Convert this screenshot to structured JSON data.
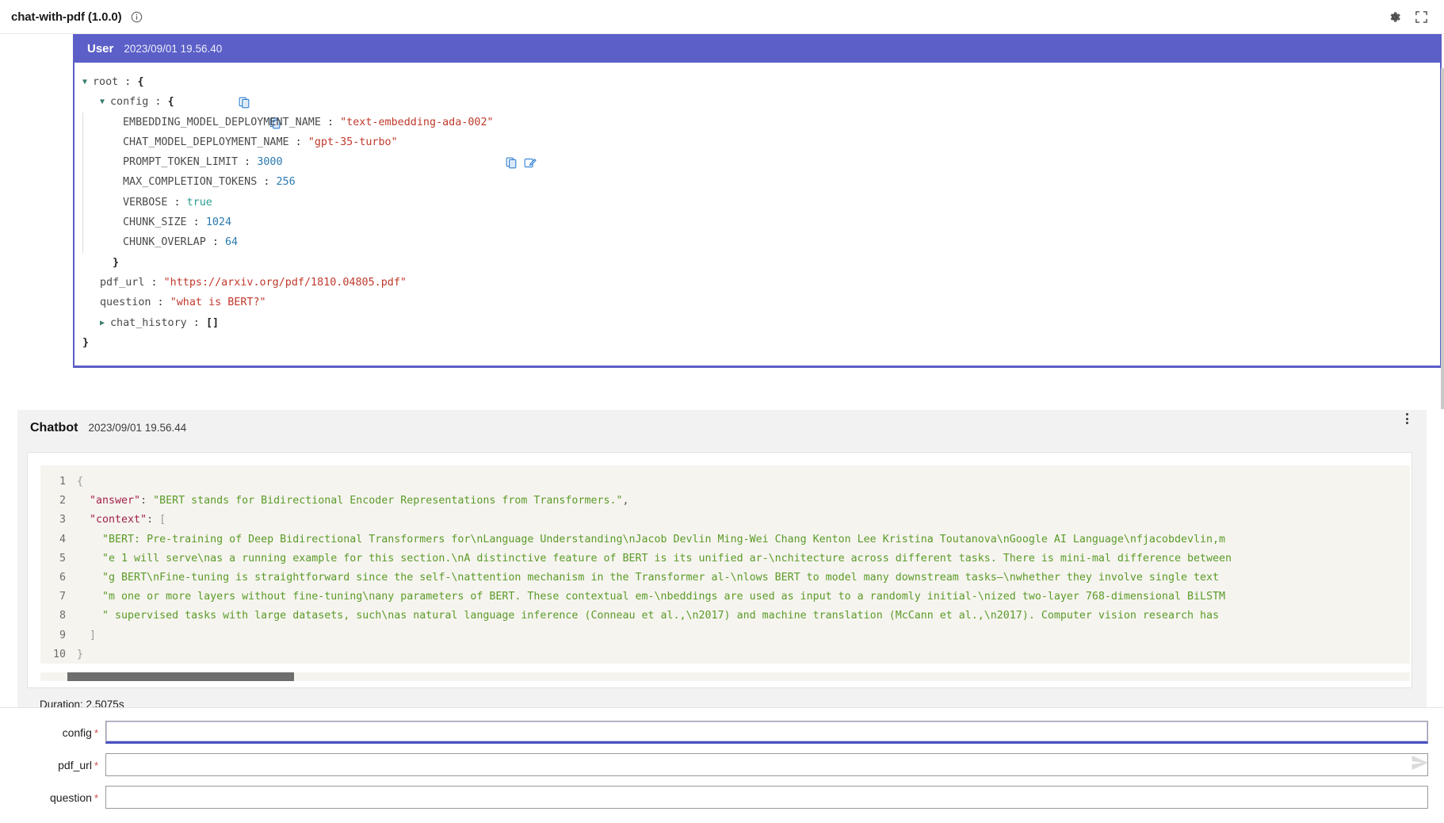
{
  "topbar": {
    "title": "chat-with-pdf (1.0.0)",
    "info_icon": "info-circle-icon",
    "settings_icon": "gear-icon",
    "fullscreen_icon": "expand-icon"
  },
  "user_message": {
    "role": "User",
    "timestamp": "2023/09/01 19.56.40",
    "tree": {
      "root_label": "root",
      "root_open_brace": "{",
      "config_label": "config",
      "config_open_brace": "{",
      "config_close_brace": "}",
      "root_close_brace": "}",
      "fields": [
        {
          "key": "EMBEDDING_MODEL_DEPLOYMENT_NAME",
          "value": "\"text-embedding-ada-002\"",
          "type": "string"
        },
        {
          "key": "CHAT_MODEL_DEPLOYMENT_NAME",
          "value": "\"gpt-35-turbo\"",
          "type": "string"
        },
        {
          "key": "PROMPT_TOKEN_LIMIT",
          "value": "3000",
          "type": "number"
        },
        {
          "key": "MAX_COMPLETION_TOKENS",
          "value": "256",
          "type": "number"
        },
        {
          "key": "VERBOSE",
          "value": "true",
          "type": "boolean"
        },
        {
          "key": "CHUNK_SIZE",
          "value": "1024",
          "type": "number"
        },
        {
          "key": "CHUNK_OVERLAP",
          "value": "64",
          "type": "number"
        }
      ],
      "pdf_url_key": "pdf_url",
      "pdf_url_value": "\"https://arxiv.org/pdf/1810.04805.pdf\"",
      "question_key": "question",
      "question_value": "\"what is BERT?\"",
      "chat_history_key": "chat_history",
      "chat_history_value": "[]",
      "colon": " : ",
      "copy_icon": "copy-icon",
      "edit_icon": "edit-icon"
    }
  },
  "bot_message": {
    "role": "Chatbot",
    "timestamp": "2023/09/01 19.56.44",
    "menu_icon": "kebab-menu-icon",
    "duration": "Duration: 2.5075s",
    "code": {
      "lines": [
        {
          "n": "1",
          "segments": [
            {
              "t": "punct",
              "s": "{"
            }
          ]
        },
        {
          "n": "2",
          "segments": [
            {
              "t": "plain",
              "s": "  "
            },
            {
              "t": "key",
              "s": "\"answer\""
            },
            {
              "t": "colon",
              "s": ": "
            },
            {
              "t": "str",
              "s": "\"BERT stands for Bidirectional Encoder Representations from Transformers.\""
            },
            {
              "t": "colon",
              "s": ","
            }
          ]
        },
        {
          "n": "3",
          "segments": [
            {
              "t": "plain",
              "s": "  "
            },
            {
              "t": "key",
              "s": "\"context\""
            },
            {
              "t": "colon",
              "s": ": "
            },
            {
              "t": "punct",
              "s": "["
            }
          ]
        },
        {
          "n": "4",
          "segments": [
            {
              "t": "plain",
              "s": "    "
            },
            {
              "t": "str",
              "s": "\"BERT: Pre-training of Deep Bidirectional Transformers for\\nLanguage Understanding\\nJacob Devlin Ming-Wei Chang Kenton Lee Kristina Toutanova\\nGoogle AI Language\\nfjacobdevlin,m"
            }
          ]
        },
        {
          "n": "5",
          "segments": [
            {
              "t": "plain",
              "s": "    "
            },
            {
              "t": "str",
              "s": "\"e 1 will serve\\nas a running example for this section.\\nA distinctive feature of BERT is its unified ar-\\nchitecture across different tasks. There is mini-mal difference between"
            }
          ]
        },
        {
          "n": "6",
          "segments": [
            {
              "t": "plain",
              "s": "    "
            },
            {
              "t": "str",
              "s": "\"g BERT\\nFine-tuning is straightforward since the self-\\nattention mechanism in the Transformer al-\\nlows BERT to model many downstream tasks—\\nwhether they involve single text"
            }
          ]
        },
        {
          "n": "7",
          "segments": [
            {
              "t": "plain",
              "s": "    "
            },
            {
              "t": "str",
              "s": "\"m one or more layers without fine-tuning\\nany parameters of BERT. These contextual em-\\nbeddings are used as input to a randomly initial-\\nized two-layer 768-dimensional BiLSTM"
            }
          ]
        },
        {
          "n": "8",
          "segments": [
            {
              "t": "plain",
              "s": "    "
            },
            {
              "t": "str",
              "s": "\" supervised tasks with large datasets, such\\nas natural language inference (Conneau et al.,\\n2017) and machine translation (McCann et al.,\\n2017). Computer vision research has"
            }
          ]
        },
        {
          "n": "9",
          "segments": [
            {
              "t": "plain",
              "s": "  "
            },
            {
              "t": "punct",
              "s": "]"
            }
          ]
        },
        {
          "n": "10",
          "segments": [
            {
              "t": "punct",
              "s": "}"
            }
          ]
        }
      ]
    }
  },
  "form": {
    "fields": [
      {
        "label": "config",
        "required": "*",
        "value": "",
        "placeholder": "",
        "focused": true
      },
      {
        "label": "pdf_url",
        "required": "*",
        "value": "",
        "placeholder": "",
        "focused": false
      },
      {
        "label": "question",
        "required": "*",
        "value": "",
        "placeholder": "",
        "focused": false
      }
    ],
    "send_icon": "send-icon"
  },
  "colors": {
    "user_accent": "#5b5fc7",
    "focus_underline": "#4b51c0",
    "string": "#c0392b",
    "number": "#2a7ab0",
    "boolean": "#2a9d8f",
    "code_string": "#5a9b28",
    "code_key": "#a0204c"
  }
}
